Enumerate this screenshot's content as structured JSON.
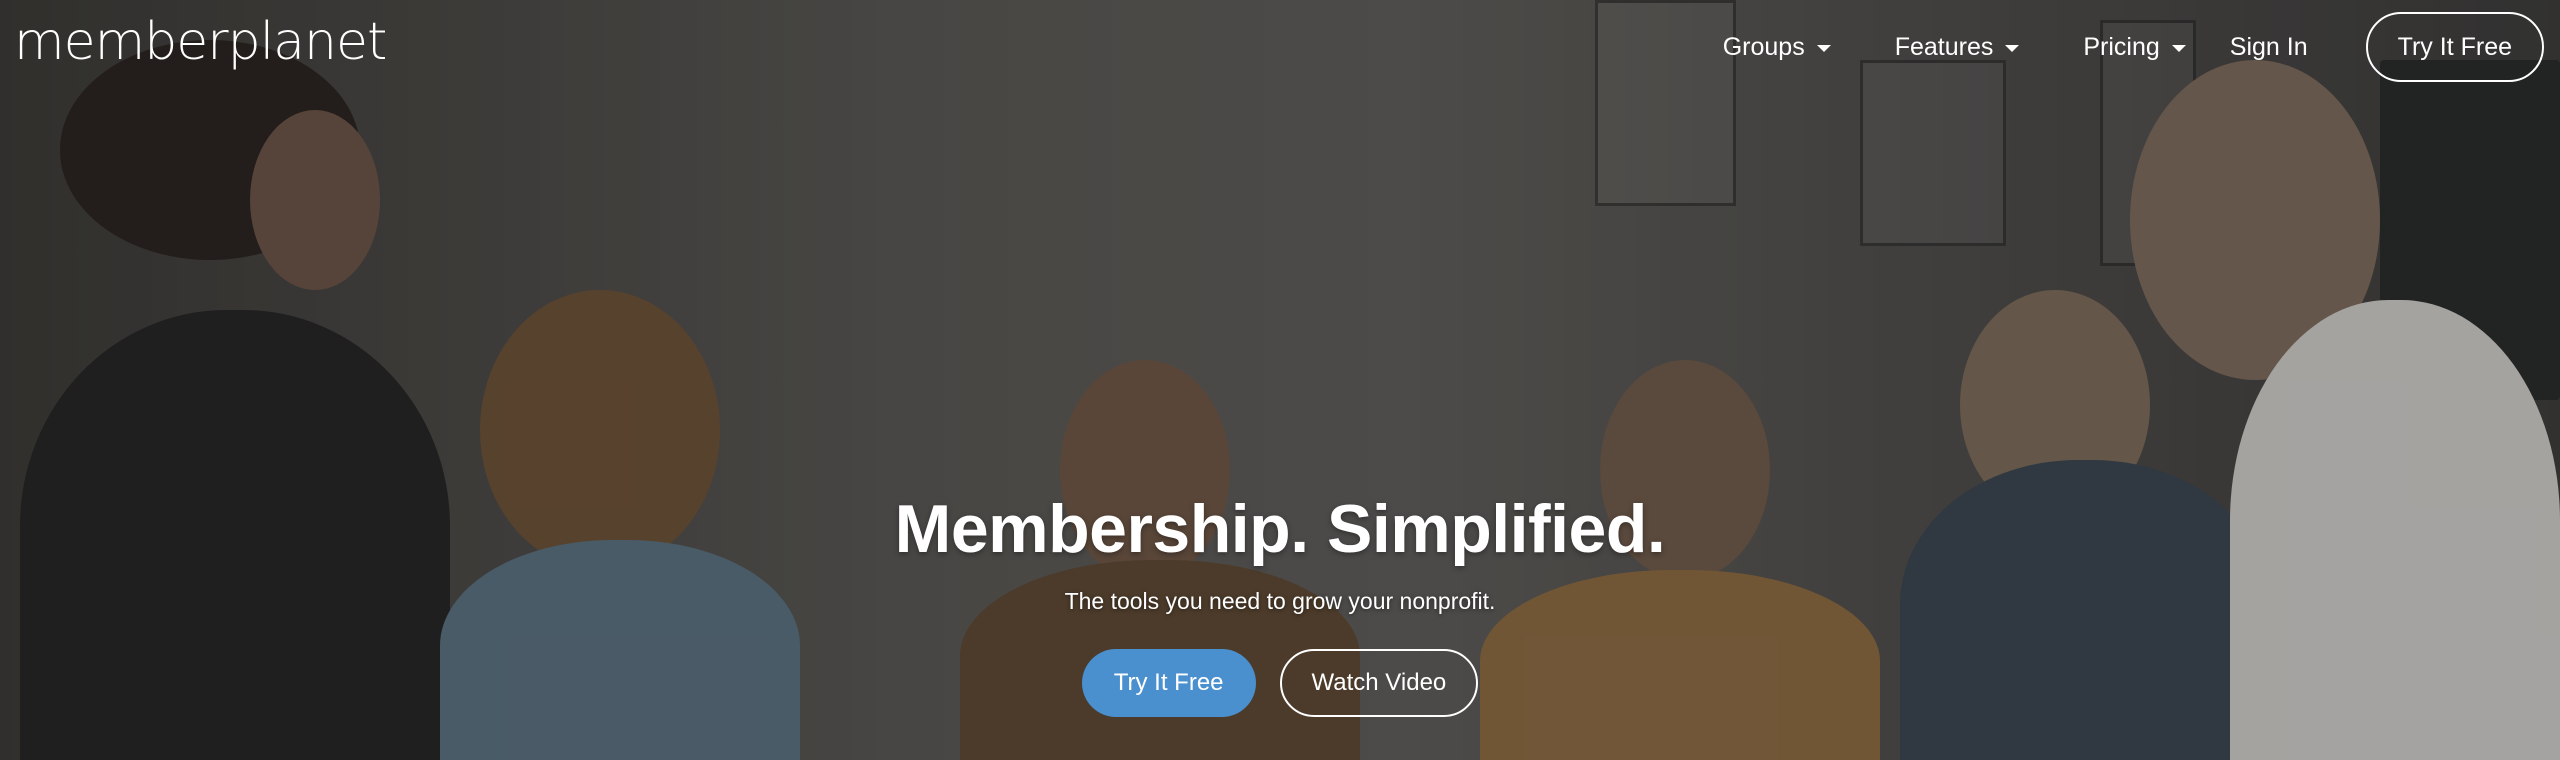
{
  "brand": {
    "logo_text": "memberplanet"
  },
  "nav": {
    "items": [
      {
        "label": "Groups",
        "has_dropdown": true
      },
      {
        "label": "Features",
        "has_dropdown": true
      },
      {
        "label": "Pricing",
        "has_dropdown": true
      }
    ],
    "sign_in": "Sign In",
    "cta": "Try It Free"
  },
  "hero": {
    "headline": "Membership. Simplified.",
    "subhead": "The tools you need to grow your nonprofit.",
    "primary_cta": "Try It Free",
    "secondary_cta": "Watch Video"
  },
  "colors": {
    "primary_button": "#4a90cf",
    "text": "#ffffff",
    "overlay": "rgba(0,0,0,0.18)"
  },
  "icons": {
    "dropdown": "caret-down-icon"
  }
}
